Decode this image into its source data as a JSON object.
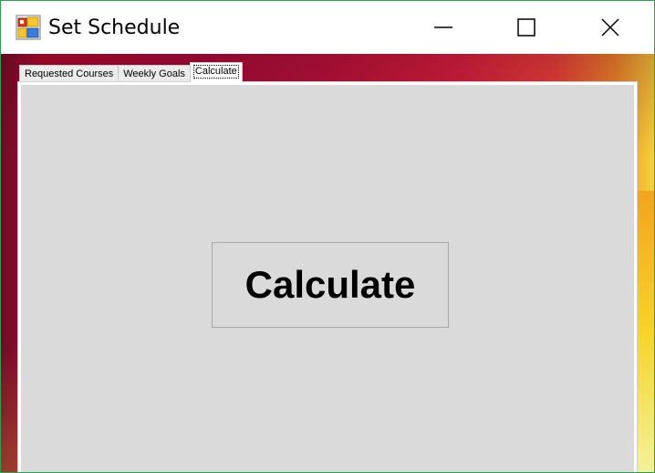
{
  "window": {
    "title": "Set Schedule",
    "app_icon": "form-app-icon",
    "controls": {
      "minimize_icon": "minimize-icon",
      "maximize_icon": "maximize-icon",
      "close_icon": "close-icon"
    },
    "border_color": "#2e9e4f"
  },
  "tabs": [
    {
      "label": "Requested Courses",
      "active": false
    },
    {
      "label": "Weekly Goals",
      "active": false
    },
    {
      "label": "Calculate",
      "active": true
    }
  ],
  "main": {
    "calculate_button_label": "Calculate"
  },
  "colors": {
    "page_background": "#dadada",
    "wallpaper_start": "#a80c2e",
    "wallpaper_end": "#f5d33a"
  }
}
